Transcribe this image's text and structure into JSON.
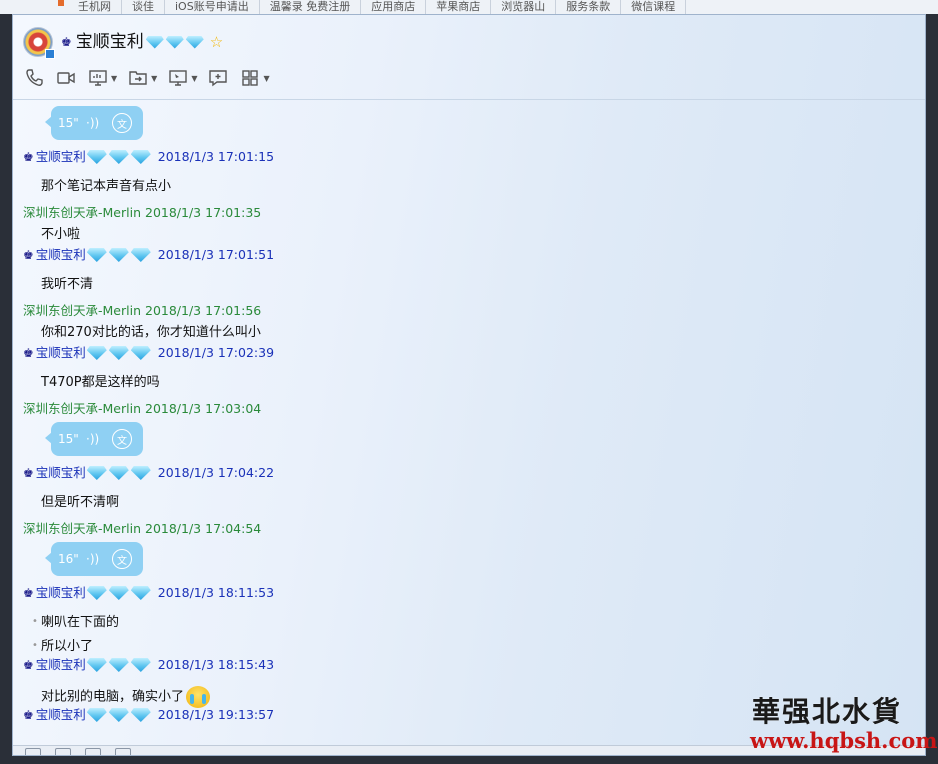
{
  "bg_tabs": [
    "壬机网",
    "谈佳",
    "iOS账号申请出",
    "温馨录 免费注册",
    "应用商店",
    "苹果商店",
    "浏览器山",
    "服务条款",
    "微信课程"
  ],
  "contact": {
    "name": "宝顺宝利",
    "crown": "♚"
  },
  "toolbar": {
    "icons": [
      "phone-icon",
      "video-icon",
      "screen-share-icon",
      "file-transfer-icon",
      "remote-desktop-icon",
      "add-app-icon",
      "grid-apps-icon"
    ]
  },
  "colors": {
    "self_name": "#1a31b8",
    "other_name": "#2a8a3a",
    "voice_bubble": "#8fd0f3"
  },
  "voice_label_convert": "文",
  "messages": [
    {
      "type": "voice",
      "duration": "15\""
    },
    {
      "type": "head",
      "sender": "宝顺宝利",
      "self": true,
      "time": "2018/1/3 17:01:15"
    },
    {
      "type": "text",
      "text": "那个笔记本声音有点小"
    },
    {
      "type": "head",
      "sender": "深圳东创天承-Merlin",
      "self": false,
      "time": "2018/1/3 17:01:35"
    },
    {
      "type": "text",
      "text": "不小啦"
    },
    {
      "type": "head",
      "sender": "宝顺宝利",
      "self": true,
      "time": "2018/1/3 17:01:51"
    },
    {
      "type": "text",
      "text": "我听不清"
    },
    {
      "type": "head",
      "sender": "深圳东创天承-Merlin",
      "self": false,
      "time": "2018/1/3 17:01:56"
    },
    {
      "type": "text",
      "text": "你和270对比的话，你才知道什么叫小"
    },
    {
      "type": "head",
      "sender": "宝顺宝利",
      "self": true,
      "time": "2018/1/3 17:02:39"
    },
    {
      "type": "text",
      "text": "T470P都是这样的吗"
    },
    {
      "type": "head",
      "sender": "深圳东创天承-Merlin",
      "self": false,
      "time": "2018/1/3 17:03:04"
    },
    {
      "type": "voice",
      "duration": "15\""
    },
    {
      "type": "head",
      "sender": "宝顺宝利",
      "self": true,
      "time": "2018/1/3 17:04:22"
    },
    {
      "type": "text",
      "text": "但是听不清啊"
    },
    {
      "type": "head",
      "sender": "深圳东创天承-Merlin",
      "self": false,
      "time": "2018/1/3 17:04:54"
    },
    {
      "type": "voice",
      "duration": "16\""
    },
    {
      "type": "head",
      "sender": "宝顺宝利",
      "self": true,
      "time": "2018/1/3 18:11:53"
    },
    {
      "type": "text",
      "text": "喇叭在下面的",
      "bullet": true
    },
    {
      "type": "text",
      "text": "所以小了",
      "bullet": true
    },
    {
      "type": "head",
      "sender": "宝顺宝利",
      "self": true,
      "time": "2018/1/3 18:15:43"
    },
    {
      "type": "text",
      "text": "对比别的电脑，确实小了",
      "emoji": "crying-face"
    },
    {
      "type": "head",
      "sender": "宝顺宝利",
      "self": true,
      "time": "2018/1/3 19:13:57"
    }
  ],
  "watermark": {
    "cn": "華强北水貨",
    "url": "www.hqbsh.com"
  }
}
